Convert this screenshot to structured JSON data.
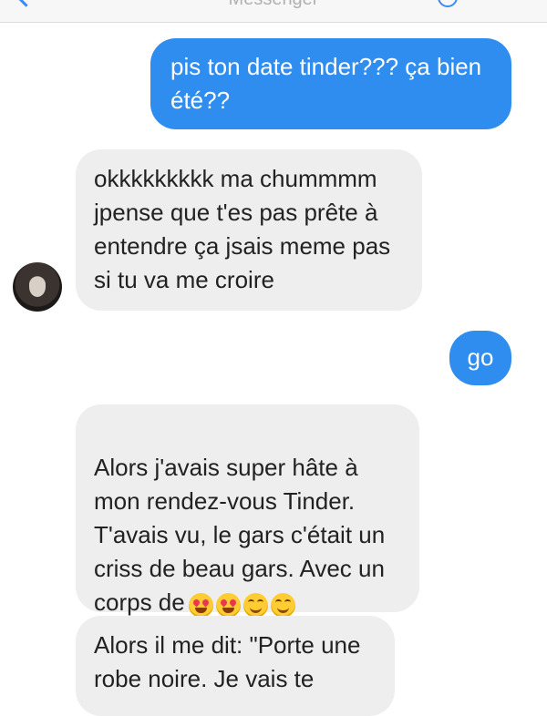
{
  "header": {
    "title": "Messenger"
  },
  "messages": {
    "m1": {
      "text": "pis ton date tinder??? ça bien\nété??"
    },
    "m2": {
      "text": "okkkkkkkkk ma chummmm\njpense que t'es pas prête à\nentendre ça jsais meme pas\nsi tu va me croire"
    },
    "m3": {
      "text": "go"
    },
    "m4": {
      "text": "Alors j'avais super hâte à\nmon rendez-vous Tinder.\nT'avais vu, le gars c'était un\ncriss de beau gars. Avec un\ncorps de",
      "emoji": [
        "heart-eyes-emoji",
        "heart-eyes-emoji",
        "yum-emoji",
        "smiling-emoji"
      ]
    },
    "m5": {
      "text": "Alors il me dit: \"Porte une\nrobe noire. Je vais te"
    }
  }
}
